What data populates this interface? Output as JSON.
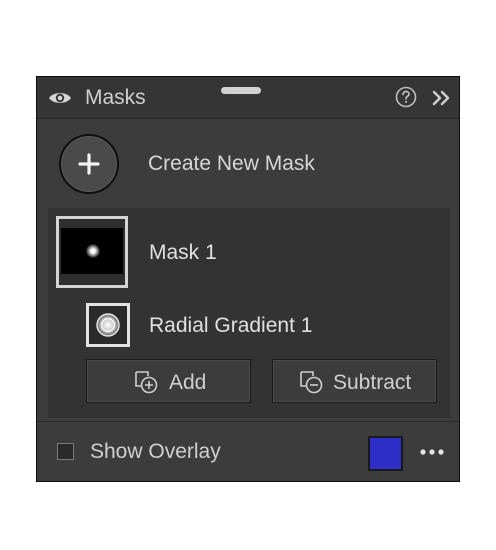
{
  "panel": {
    "title": "Masks",
    "help_icon": "help-circle-icon",
    "collapse_icon": "double-chevron-right-icon",
    "visibility_icon": "eye-icon"
  },
  "create": {
    "label": "Create New Mask",
    "icon": "plus-icon"
  },
  "mask": {
    "name": "Mask 1",
    "component": {
      "name": "Radial Gradient 1",
      "icon": "radial-gradient-icon"
    },
    "add_label": "Add",
    "add_icon": "add-mask-icon",
    "subtract_label": "Subtract",
    "subtract_icon": "subtract-mask-icon"
  },
  "footer": {
    "overlay_label": "Show Overlay",
    "overlay_checked": false,
    "overlay_color": "#2d2dc8",
    "more_icon": "more-horizontal-icon"
  },
  "colors": {
    "panel_bg": "#3c3c3c",
    "header_bg": "#353535",
    "mask_section_bg": "#333333",
    "text": "#d6d6d6"
  }
}
